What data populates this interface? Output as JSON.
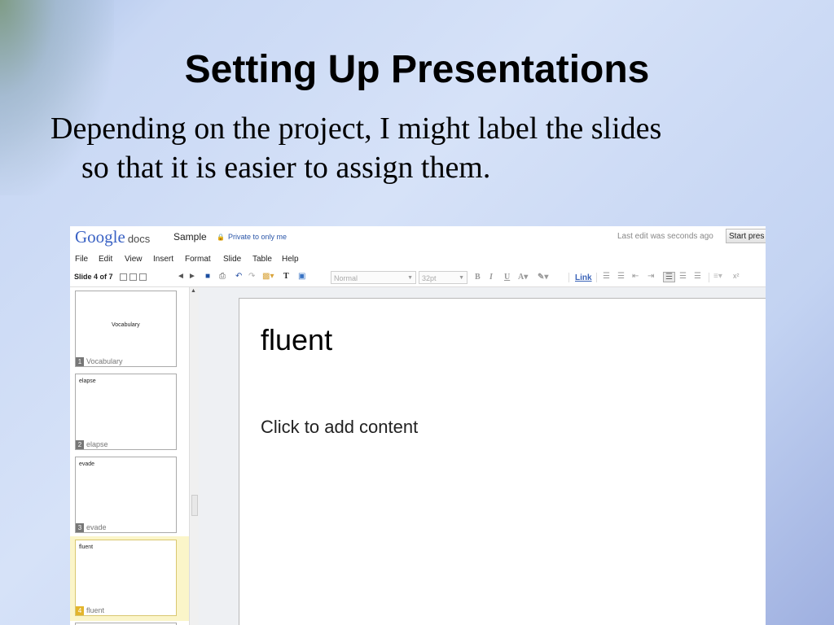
{
  "slide": {
    "title": "Setting Up Presentations",
    "body_line1": "Depending on the project, I might label the slides",
    "body_line2": "so that it is easier to assign them."
  },
  "app": {
    "logo_google": "Google",
    "logo_docs": "docs",
    "doc_title": "Sample",
    "privacy": "Private to only me",
    "last_edit": "Last edit was seconds ago",
    "start_button": "Start pres"
  },
  "menu": [
    "File",
    "Edit",
    "View",
    "Insert",
    "Format",
    "Slide",
    "Table",
    "Help"
  ],
  "toolbar": {
    "slide_count": "Slide 4 of 7",
    "style_select": "Normal",
    "size_select": "32pt",
    "link": "Link"
  },
  "thumbnails": [
    {
      "num": "1",
      "label": "Vocabulary",
      "text": "Vocabulary",
      "selected": false
    },
    {
      "num": "2",
      "label": "elapse",
      "text": "elapse",
      "selected": false
    },
    {
      "num": "3",
      "label": "evade",
      "text": "evade",
      "selected": false
    },
    {
      "num": "4",
      "label": "fluent",
      "text": "fluent",
      "selected": true
    }
  ],
  "editor": {
    "title": "fluent",
    "placeholder": "Click to add content"
  }
}
